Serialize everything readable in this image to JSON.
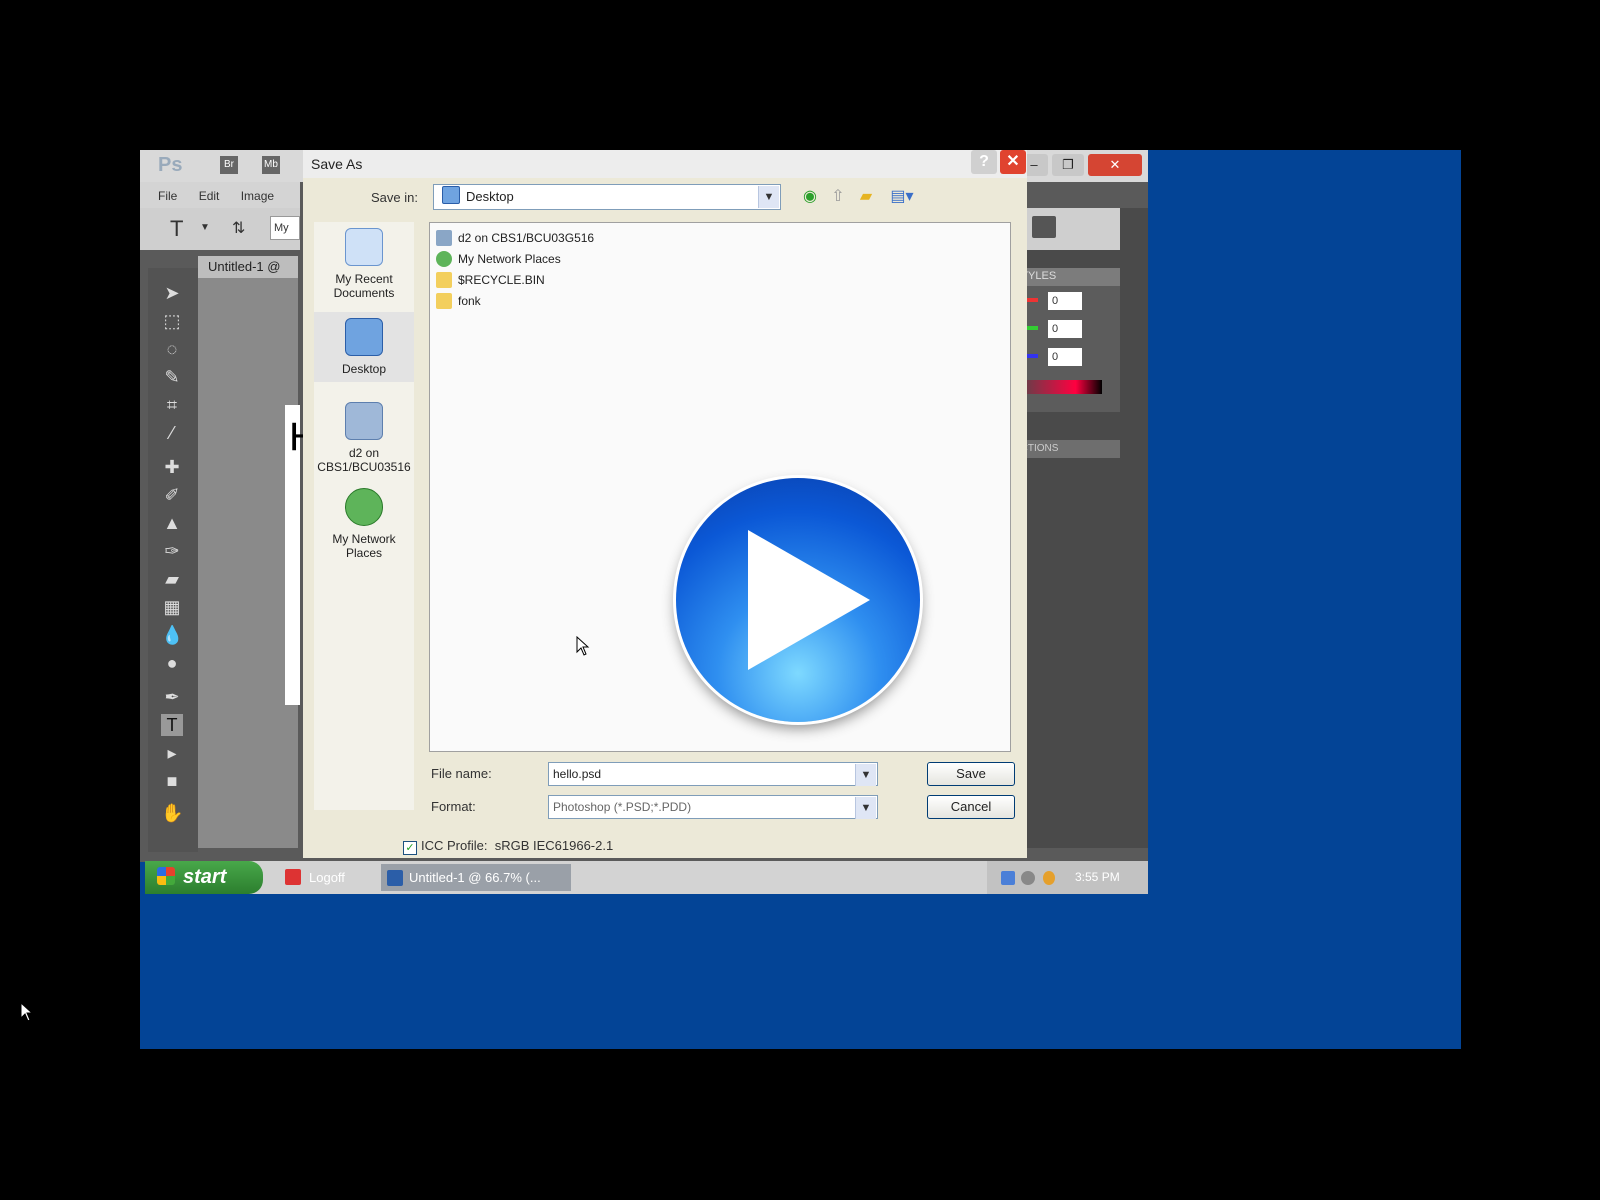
{
  "photoshop": {
    "logo": "Ps",
    "badges": [
      "Br",
      "Mb"
    ],
    "menu": [
      "File",
      "Edit",
      "Image"
    ],
    "doc_tab": "Untitled-1 @",
    "canvas_letter": "H",
    "styles_tab": "STYLES",
    "actions_tab": "ACTIONS",
    "color_values": [
      "0",
      "0",
      "0"
    ],
    "option_field": "My"
  },
  "dialog": {
    "title": "Save As",
    "help_label": "?",
    "close_label": "✕",
    "save_in_label": "Save in:",
    "save_in_value": "Desktop",
    "places": [
      {
        "label": "My Recent Documents"
      },
      {
        "label": "Desktop"
      },
      {
        "label": "d2 on CBS1/BCU03516"
      },
      {
        "label": "My Network Places"
      }
    ],
    "files": [
      {
        "name": "d2 on CBS1/BCU03G516",
        "icon": "drive-icon"
      },
      {
        "name": "My Network Places",
        "icon": "network-icon"
      },
      {
        "name": "$RECYCLE.BIN",
        "icon": "folder-icon"
      },
      {
        "name": "fonk",
        "icon": "folder-icon"
      }
    ],
    "file_name_label": "File name:",
    "file_name_value": "hello.psd",
    "format_label": "Format:",
    "format_value": "Photoshop (*.PSD;*.PDD)",
    "save_label": "Save",
    "cancel_label": "Cancel",
    "icc_label": "ICC Profile:",
    "icc_value": "sRGB IEC61966-2.1"
  },
  "taskbar": {
    "start_label": "start",
    "items": [
      {
        "label": "Logoff"
      },
      {
        "label": "Untitled-1 @ 66.7% (..."
      }
    ],
    "clock": "3:55 PM"
  },
  "colors": {
    "desktop": "#034496",
    "play_button": "#0b58d6",
    "close_red": "#e0432f"
  }
}
